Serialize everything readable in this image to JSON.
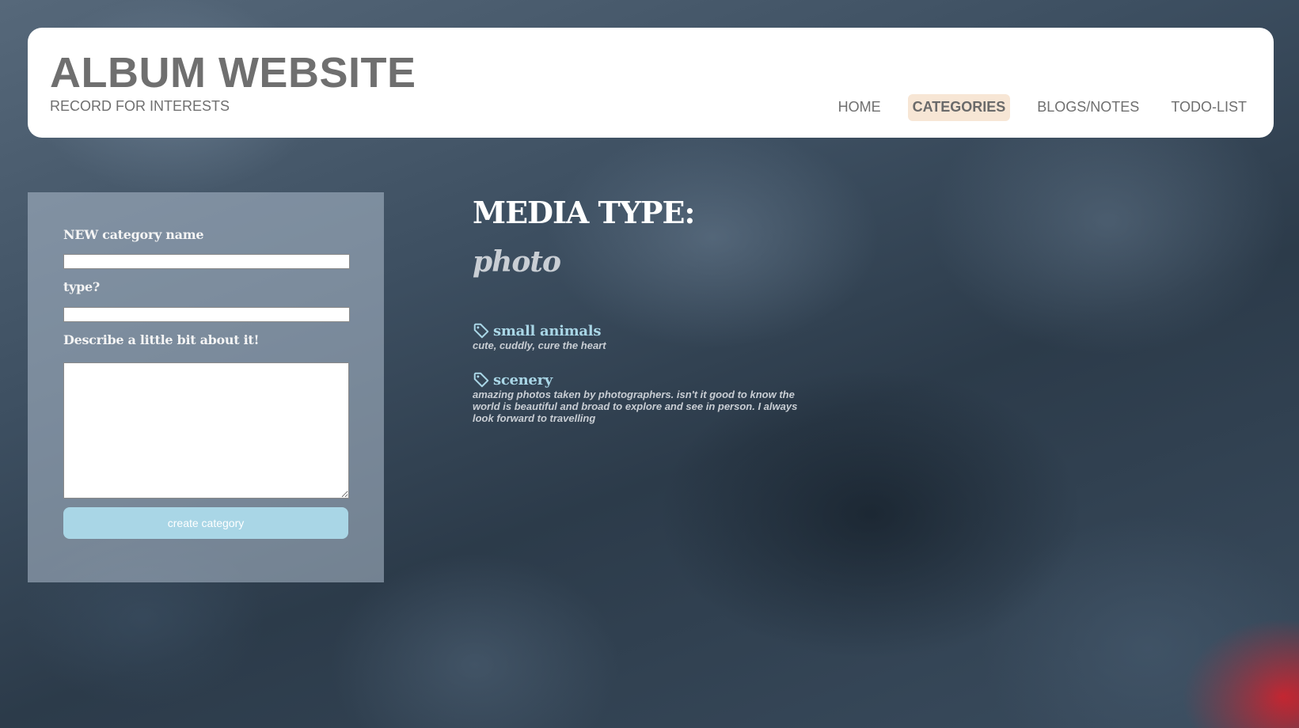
{
  "header": {
    "title": "ALBUM WEBSITE",
    "subtitle": "RECORD FOR INTERESTS",
    "nav": [
      {
        "label": "HOME"
      },
      {
        "label": "CATEGORIES"
      },
      {
        "label": "BLOGS/NOTES"
      },
      {
        "label": "TODO-LIST"
      }
    ],
    "active_nav": "CATEGORIES"
  },
  "form": {
    "name_label": "NEW category name",
    "name_value": "",
    "type_label": "type?",
    "type_value": "",
    "description_label": "Describe a little bit about it!",
    "description_value": "",
    "submit_label": "create category"
  },
  "media": {
    "heading": "MEDIA TYPE:",
    "type_value": "photo",
    "categories": [
      {
        "icon": "tag-icon",
        "name": "small animals",
        "description": "cute, cuddly, cure the heart"
      },
      {
        "icon": "tag-icon",
        "name": "scenery",
        "description": "amazing photos taken by photographers. isn't it good to know the world is beautiful and broad to explore and see in person. I always look forward to travelling"
      }
    ]
  },
  "colors": {
    "accent": "#a9d6e6",
    "active_nav_bg": "#f7e6d5",
    "title_gray": "#6f6f6f"
  }
}
